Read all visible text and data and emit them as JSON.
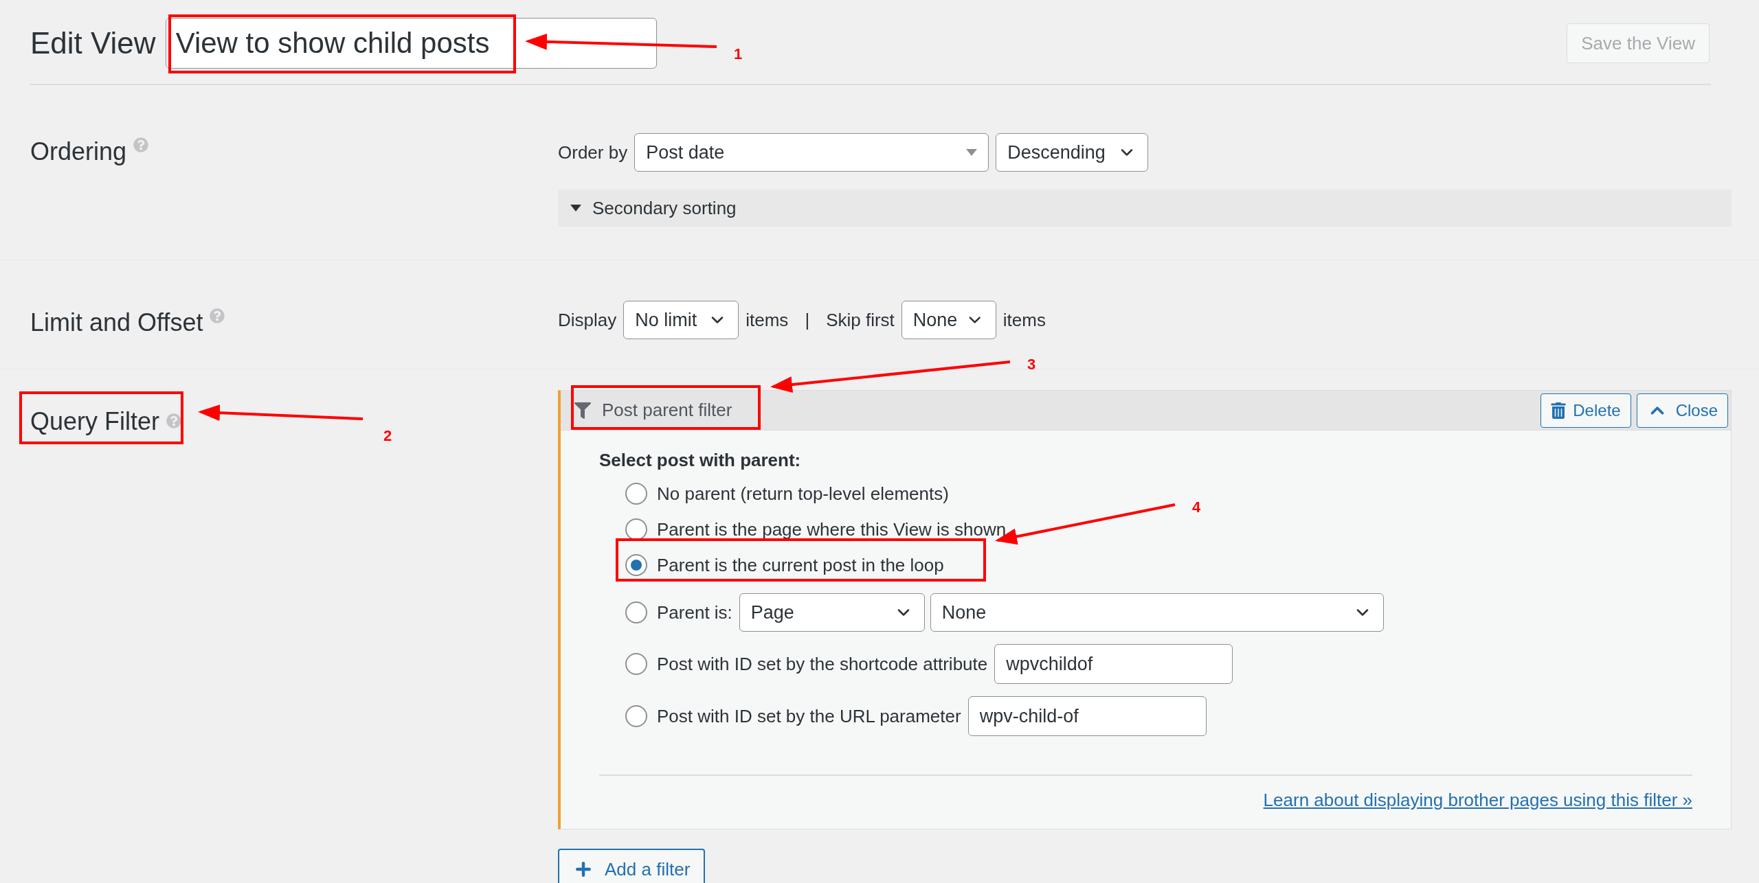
{
  "header": {
    "title": "Edit View",
    "view_name": "View to show child posts",
    "save_button": {
      "label": "Save the View",
      "disabled": true
    }
  },
  "ordering": {
    "title": "Ordering",
    "order_by_label": "Order by",
    "order_by": "Post date",
    "direction": "Descending",
    "secondary": {
      "label": "Secondary sorting",
      "expanded": false
    }
  },
  "limit_offset": {
    "title": "Limit and Offset",
    "display_label": "Display",
    "display": "No limit",
    "items_label": "items",
    "separator": "|",
    "skip_label": "Skip first",
    "skip": "None",
    "skip_items_label": "items"
  },
  "query_filter": {
    "title": "Query Filter",
    "filter_title": "Post parent filter",
    "delete_button": "Delete",
    "close_button": "Close",
    "prompt": "Select post with parent:",
    "options": [
      {
        "kind": "plain",
        "label": "No parent (return top-level elements)",
        "selected": false
      },
      {
        "kind": "plain",
        "label": "Parent is the page where this View is shown",
        "selected": false
      },
      {
        "kind": "plain",
        "label": "Parent is the current post in the loop",
        "selected": true
      },
      {
        "kind": "selects",
        "label": "Parent is:",
        "post_type": "Page",
        "parent": "None",
        "selected": false
      },
      {
        "kind": "input",
        "label": "Post with ID set by the shortcode attribute",
        "value": "wpvchildof",
        "selected": false
      },
      {
        "kind": "input",
        "label": "Post with ID set by the URL parameter",
        "value": "wpv-child-of",
        "selected": false
      }
    ],
    "help_link": "Learn about displaying brother pages using this filter »",
    "add_button": "Add a filter"
  },
  "annotations": [
    {
      "number": "1"
    },
    {
      "number": "2"
    },
    {
      "number": "3"
    },
    {
      "number": "4"
    }
  ]
}
